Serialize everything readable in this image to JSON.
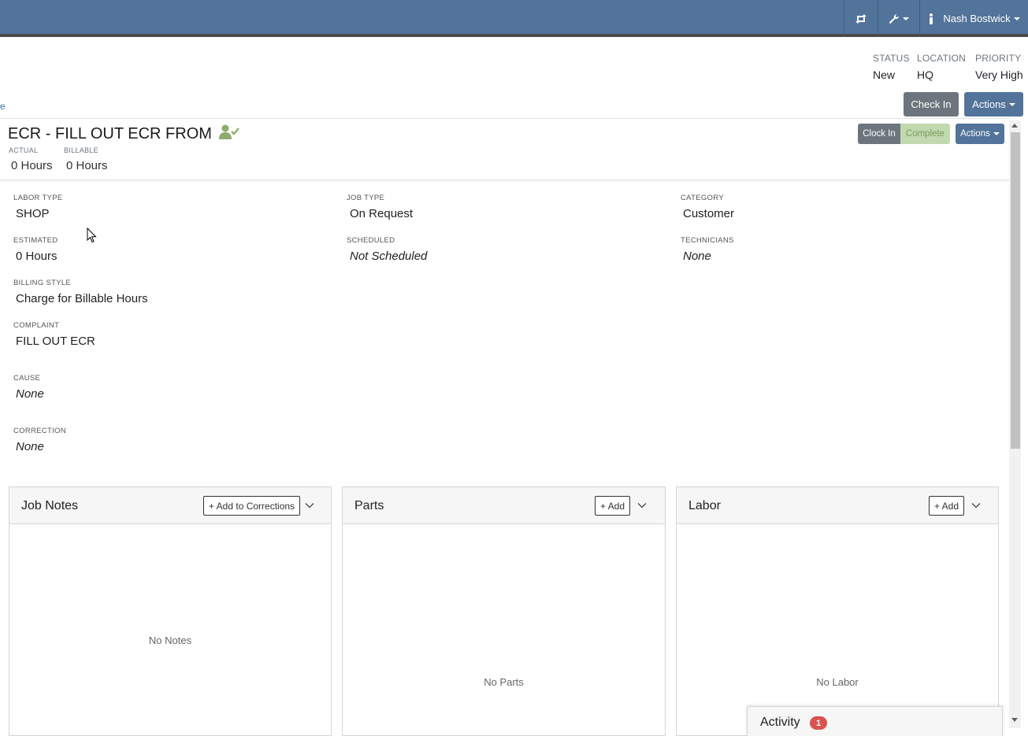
{
  "navbar": {
    "user_name": "Nash Bostwick",
    "color": "#52739a"
  },
  "summary": {
    "status_label": "STATUS",
    "status_value": "New",
    "location_label": "LOCATION",
    "location_value": "HQ",
    "priority_label": "PRIORITY",
    "priority_value": "Very High"
  },
  "order_buttons": {
    "check_in": "Check In",
    "actions": "Actions"
  },
  "edge_link": "e",
  "job": {
    "title": "ECR - FILL OUT ECR FROM",
    "actual_label": "ACTUAL",
    "actual_value": "0 Hours",
    "billable_label": "BILLABLE",
    "billable_value": "0 Hours",
    "clock_in": "Clock In",
    "complete": "Complete",
    "actions": "Actions"
  },
  "fields": {
    "labor_type_label": "LABOR TYPE",
    "labor_type": "SHOP",
    "job_type_label": "JOB TYPE",
    "job_type": "On Request",
    "category_label": "CATEGORY",
    "category": "Customer",
    "estimated_label": "ESTIMATED",
    "estimated": "0 Hours",
    "scheduled_label": "SCHEDULED",
    "scheduled": "Not Scheduled",
    "technicians_label": "TECHNICIANS",
    "technicians": "None",
    "billing_style_label": "BILLING STYLE",
    "billing_style": "Charge for Billable Hours",
    "complaint_label": "COMPLAINT",
    "complaint": "FILL OUT ECR",
    "cause_label": "CAUSE",
    "cause": "None",
    "correction_label": "CORRECTION",
    "correction": "None"
  },
  "panels": {
    "notes": {
      "title": "Job Notes",
      "button": "+ Add to Corrections",
      "empty": "No Notes"
    },
    "parts": {
      "title": "Parts",
      "button": "+ Add",
      "empty": "No Parts"
    },
    "labor": {
      "title": "Labor",
      "button": "+ Add",
      "empty": "No Labor"
    }
  },
  "activity": {
    "title": "Activity",
    "count": "1"
  }
}
